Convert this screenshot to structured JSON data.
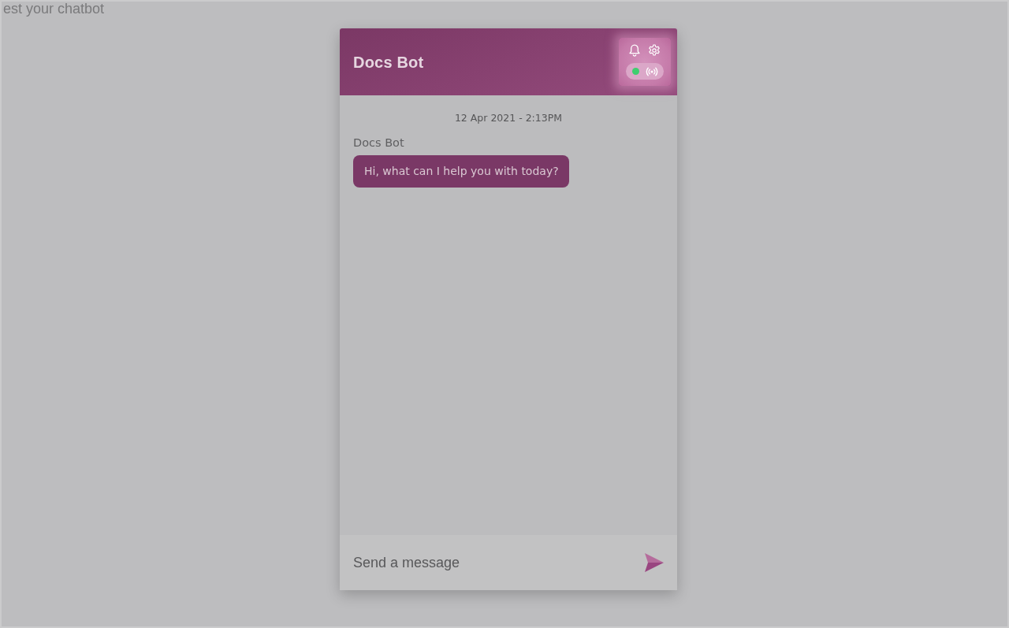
{
  "page": {
    "heading": "est your chatbot"
  },
  "chat": {
    "title": "Docs Bot",
    "status": {
      "online": true
    },
    "timestamp": "12 Apr 2021 - 2:13PM",
    "messages": [
      {
        "sender": "Docs Bot",
        "text": "Hi, what can I help you with today?"
      }
    ],
    "composer": {
      "placeholder": "Send a message"
    }
  }
}
